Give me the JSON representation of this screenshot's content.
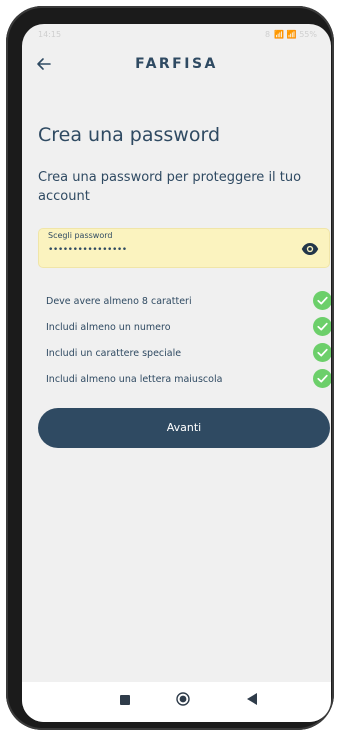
{
  "status_bar": {
    "time": "14:15",
    "right": "8  📶 📶 55%"
  },
  "header": {
    "brand": "FARFISA"
  },
  "main": {
    "title": "Crea una password",
    "subtitle": "Crea una password per proteggere il tuo account",
    "password_field": {
      "label": "Scegli password",
      "value": "••••••••••••••••"
    },
    "requirements": [
      {
        "text": "Deve avere almeno 8 caratteri",
        "met": true
      },
      {
        "text": "Includi almeno un numero",
        "met": true
      },
      {
        "text": "Includi un carattere speciale",
        "met": true
      },
      {
        "text": "Includi almeno una lettera maiuscola",
        "met": true
      }
    ],
    "submit_label": "Avanti"
  },
  "colors": {
    "primary": "#2f4a62",
    "field_bg": "#fbf3bf",
    "check": "#6ccf6a",
    "screen_bg": "#f0f0f0"
  },
  "icons": [
    "back-arrow-icon",
    "eye-icon",
    "check-circle-icon"
  ]
}
